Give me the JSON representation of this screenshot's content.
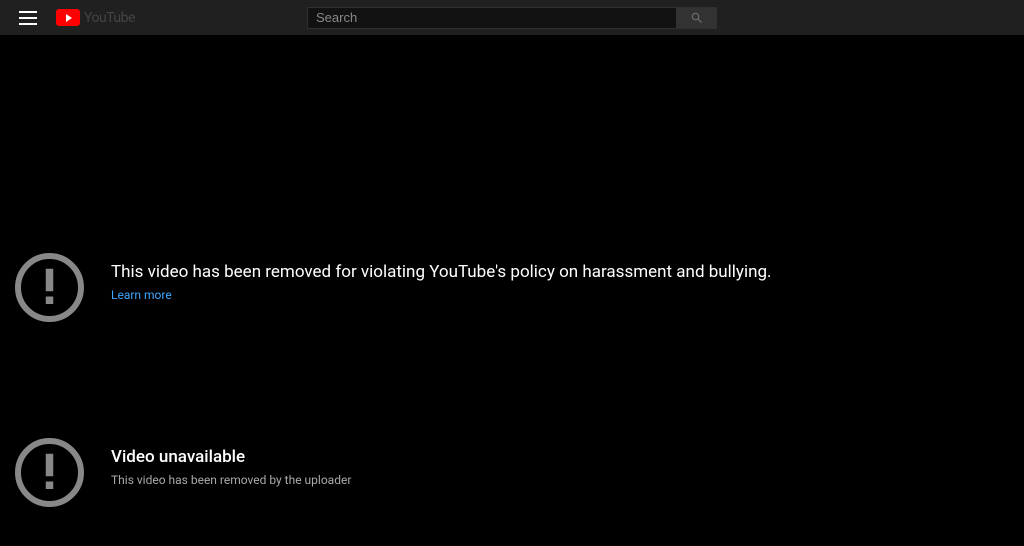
{
  "header": {
    "logo_text": "YouTube",
    "search_placeholder": "Search"
  },
  "errors": [
    {
      "title": "This video has been removed for violating YouTube's policy on harassment and bullying.",
      "link_text": "Learn more"
    },
    {
      "title": "Video unavailable",
      "subtitle": "This video has been removed by the uploader"
    }
  ]
}
